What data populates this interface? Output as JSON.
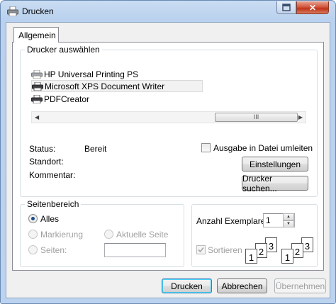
{
  "window": {
    "title": "Drucken"
  },
  "tabs": [
    {
      "label": "Allgemein"
    }
  ],
  "printer_group": {
    "label": "Drucker auswählen",
    "printers": [
      {
        "name": "HP Universal Printing PS",
        "selected": false
      },
      {
        "name": "Microsoft XPS Document Writer",
        "selected": true
      },
      {
        "name": "PDFCreator",
        "selected": false
      }
    ],
    "scroll_thumb_glyph": "III",
    "status_label": "Status:",
    "status_value": "Bereit",
    "location_label": "Standort:",
    "location_value": "",
    "comment_label": "Kommentar:",
    "comment_value": "",
    "print_to_file_label": "Ausgabe in Datei umleiten",
    "print_to_file_checked": false,
    "settings_button": "Einstellungen",
    "find_printer_button": "Drucker suchen..."
  },
  "page_range": {
    "label": "Seitenbereich",
    "all_label": "Alles",
    "selection_label": "Markierung",
    "current_page_label": "Aktuelle Seite",
    "pages_label": "Seiten:",
    "pages_value": "",
    "selected": "all"
  },
  "copies": {
    "count_label": "Anzahl Exemplare:",
    "count_value": "1",
    "collate_label": "Sortieren",
    "collate_checked": true,
    "collate_pages": [
      "1",
      "2",
      "3"
    ]
  },
  "footer": {
    "print_button": "Drucken",
    "cancel_button": "Abbrechen",
    "apply_button": "Übernehmen"
  }
}
